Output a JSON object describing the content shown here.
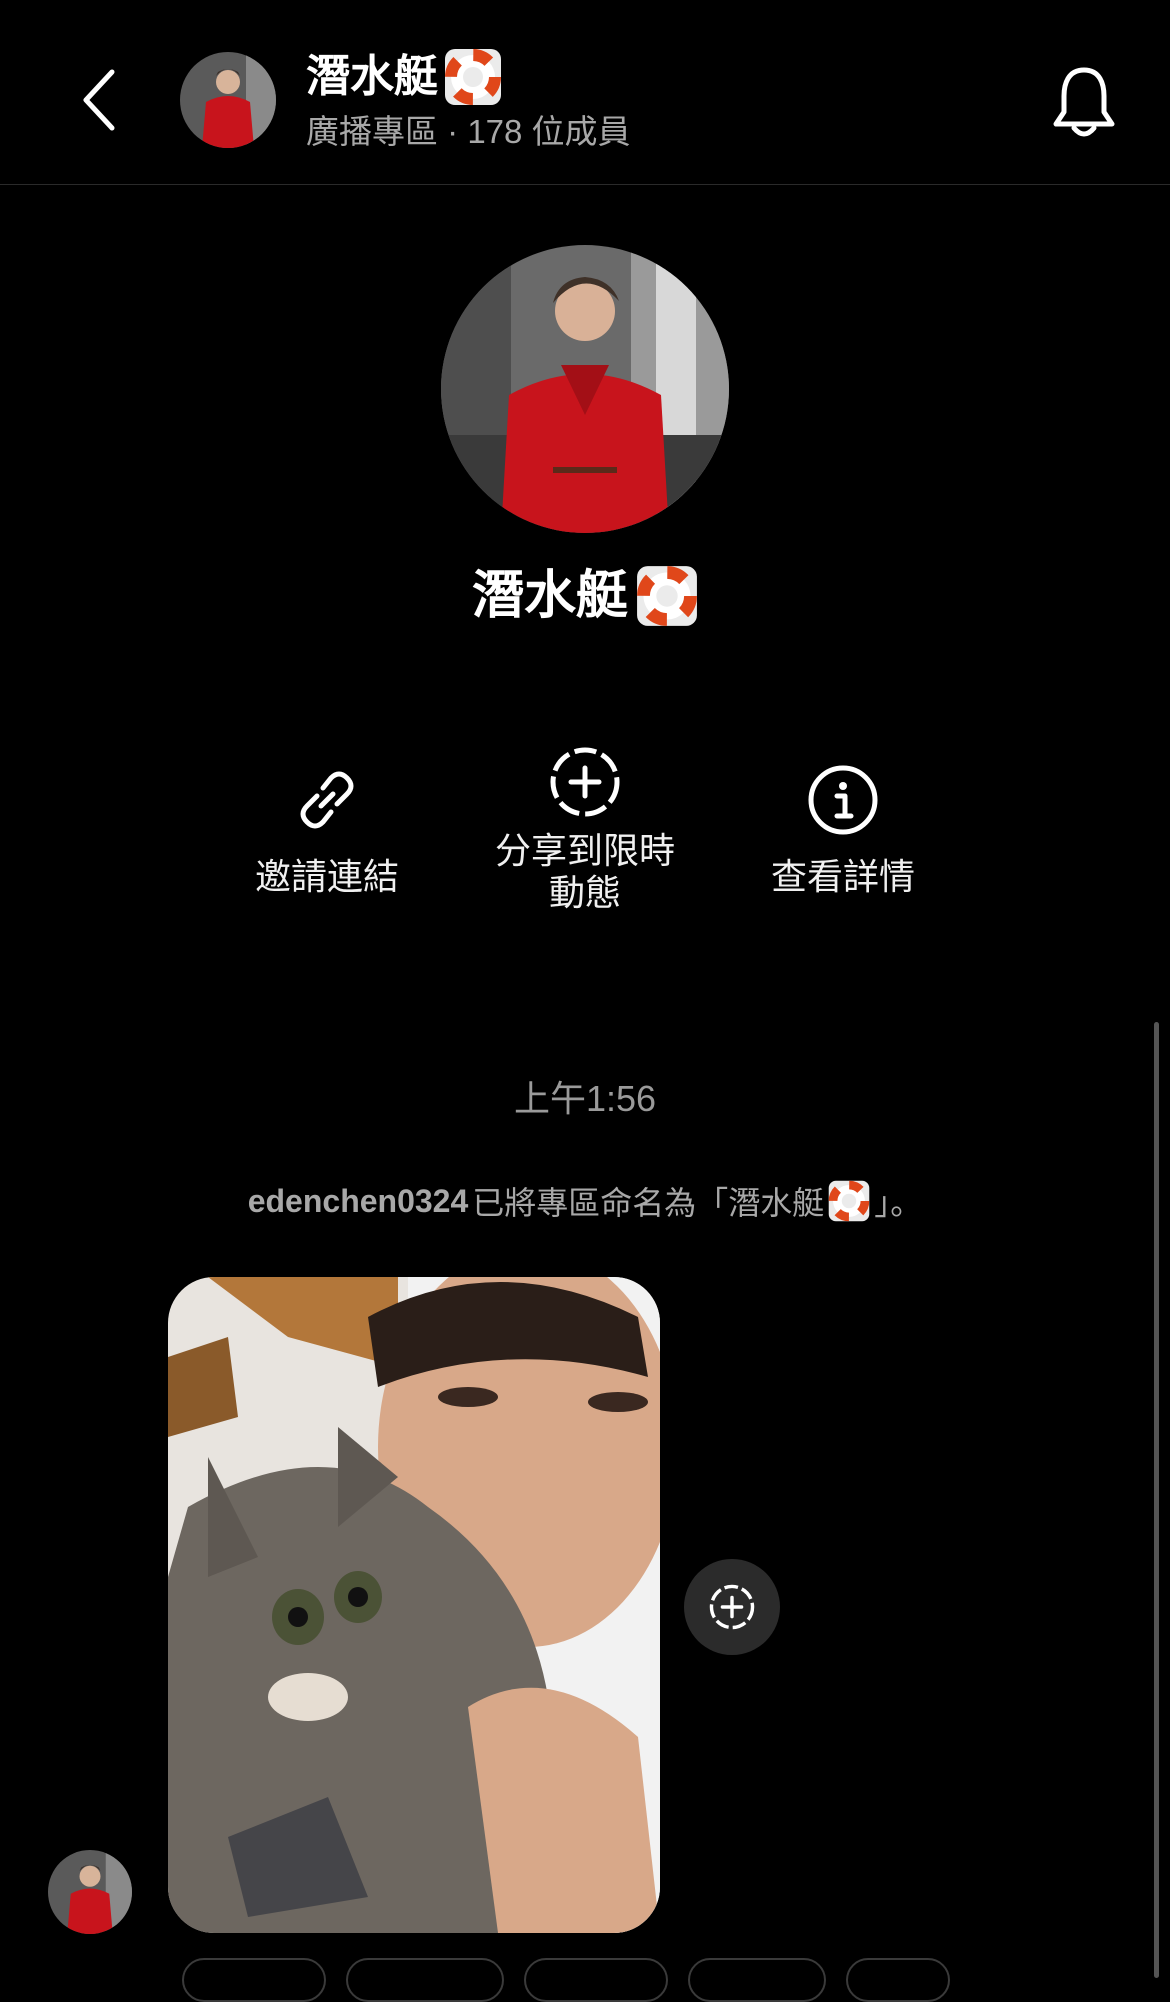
{
  "header": {
    "title": "潛水艇",
    "subtitle": "廣播專區 · 178 位成員"
  },
  "profile": {
    "name": "潛水艇"
  },
  "actions": [
    {
      "label": "邀請連結",
      "icon": "link-icon"
    },
    {
      "label_line1": "分享到限時",
      "label_line2": "動態",
      "icon": "add-story-icon"
    },
    {
      "label": "查看詳情",
      "icon": "info-icon"
    }
  ],
  "chat": {
    "timestamp": "上午1:56",
    "rename_user": "edenchen0324",
    "rename_text": "已將專區命名為「潛水艇",
    "rename_end": "」。"
  },
  "colors": {
    "background": "#000000",
    "secondary_text": "#a8a8a8",
    "jacket_red": "#c8141c",
    "button_bg": "#2b2b2b"
  }
}
